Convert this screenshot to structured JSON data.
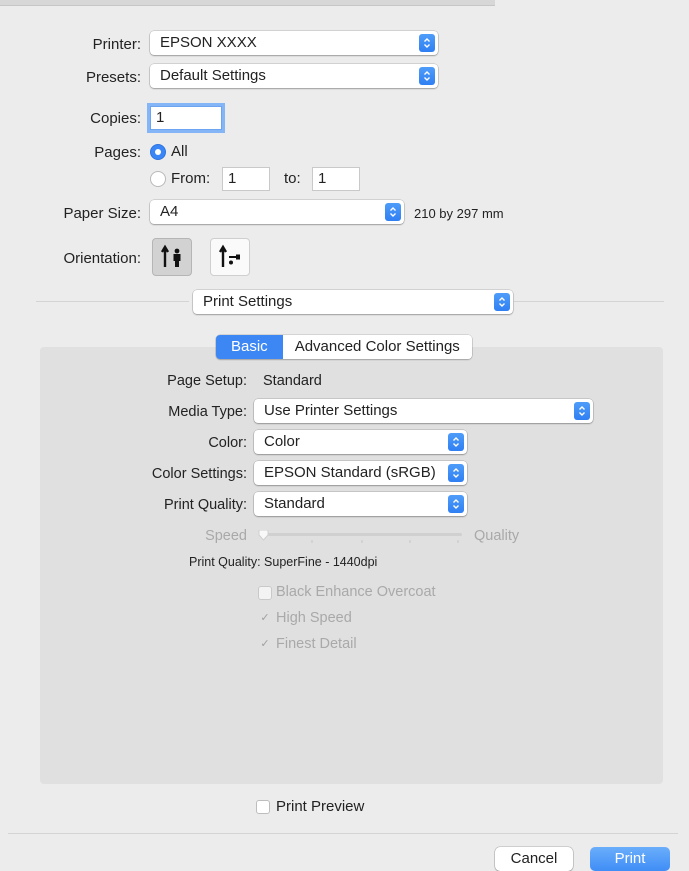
{
  "printer": {
    "label": "Printer:",
    "value": "EPSON XXXX"
  },
  "presets": {
    "label": "Presets:",
    "value": "Default Settings"
  },
  "copies": {
    "label": "Copies:",
    "value": "1"
  },
  "pages": {
    "label": "Pages:",
    "all_label": "All",
    "from_label": "From:",
    "from_value": "1",
    "to_label": "to:",
    "to_value": "1",
    "selected": "All"
  },
  "paper_size": {
    "label": "Paper Size:",
    "value": "A4",
    "dimensions": "210 by 297 mm"
  },
  "orientation": {
    "label": "Orientation:",
    "selected": "portrait"
  },
  "section_popup": {
    "value": "Print Settings"
  },
  "tabs": [
    {
      "label": "Basic",
      "active": true
    },
    {
      "label": "Advanced Color Settings",
      "active": false
    }
  ],
  "basic": {
    "page_setup": {
      "label": "Page Setup:",
      "value": "Standard"
    },
    "media_type": {
      "label": "Media Type:",
      "value": "Use Printer Settings"
    },
    "color": {
      "label": "Color:",
      "value": "Color"
    },
    "color_settings": {
      "label": "Color Settings:",
      "value": "EPSON Standard (sRGB)"
    },
    "print_quality": {
      "label": "Print Quality:",
      "value": "Standard"
    },
    "slider": {
      "left_label": "Speed",
      "right_label": "Quality",
      "enabled": false,
      "level": 0
    },
    "quality_info": {
      "label": "Print Quality:",
      "value": "SuperFine - 1440dpi"
    },
    "options": [
      {
        "label": "Black Enhance Overcoat",
        "checked": false,
        "enabled": false
      },
      {
        "label": "High Speed",
        "checked": true,
        "enabled": false
      },
      {
        "label": "Finest Detail",
        "checked": true,
        "enabled": false
      }
    ]
  },
  "print_preview": {
    "label": "Print Preview",
    "checked": false
  },
  "buttons": {
    "cancel": "Cancel",
    "print": "Print"
  },
  "colors": {
    "accent": "#3d87f5",
    "panel": "#e0e0e0",
    "window": "#ececec"
  },
  "icons": {
    "popup_arrow": "chevron-up-down-icon",
    "portrait": "portrait-orientation-icon",
    "landscape": "landscape-orientation-icon"
  }
}
